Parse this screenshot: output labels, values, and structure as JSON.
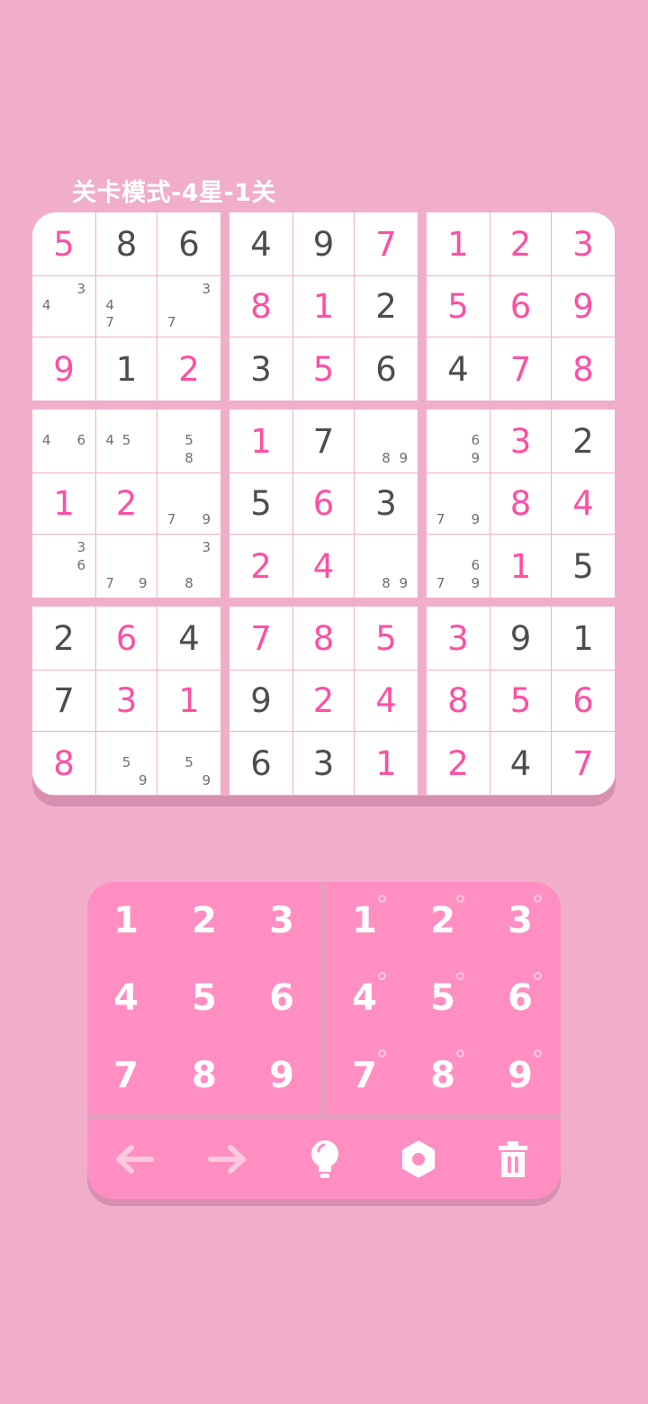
{
  "header": {
    "title": "关卡模式-4星-1关"
  },
  "board": {
    "rows": [
      [
        {
          "v": "5",
          "t": "user"
        },
        {
          "v": "8",
          "t": "given"
        },
        {
          "v": "6",
          "t": "given"
        },
        {
          "v": "4",
          "t": "given"
        },
        {
          "v": "9",
          "t": "given"
        },
        {
          "v": "7",
          "t": "user"
        },
        {
          "v": "1",
          "t": "user"
        },
        {
          "v": "2",
          "t": "user"
        },
        {
          "v": "3",
          "t": "user"
        }
      ],
      [
        {
          "n": [
            3,
            4
          ]
        },
        {
          "n": [
            4,
            7
          ]
        },
        {
          "n": [
            3,
            7
          ]
        },
        {
          "v": "8",
          "t": "user"
        },
        {
          "v": "1",
          "t": "user"
        },
        {
          "v": "2",
          "t": "given"
        },
        {
          "v": "5",
          "t": "user"
        },
        {
          "v": "6",
          "t": "user"
        },
        {
          "v": "9",
          "t": "user"
        }
      ],
      [
        {
          "v": "9",
          "t": "user"
        },
        {
          "v": "1",
          "t": "given"
        },
        {
          "v": "2",
          "t": "user"
        },
        {
          "v": "3",
          "t": "given"
        },
        {
          "v": "5",
          "t": "user"
        },
        {
          "v": "6",
          "t": "given"
        },
        {
          "v": "4",
          "t": "given"
        },
        {
          "v": "7",
          "t": "user"
        },
        {
          "v": "8",
          "t": "user"
        }
      ],
      [
        {
          "n": [
            4,
            6
          ]
        },
        {
          "n": [
            4,
            5
          ]
        },
        {
          "n": [
            5,
            8
          ]
        },
        {
          "v": "1",
          "t": "user"
        },
        {
          "v": "7",
          "t": "given"
        },
        {
          "n": [
            8,
            9
          ]
        },
        {
          "n": [
            6,
            9
          ]
        },
        {
          "v": "3",
          "t": "user"
        },
        {
          "v": "2",
          "t": "given"
        }
      ],
      [
        {
          "v": "1",
          "t": "user"
        },
        {
          "v": "2",
          "t": "user"
        },
        {
          "n": [
            7,
            9
          ]
        },
        {
          "v": "5",
          "t": "given"
        },
        {
          "v": "6",
          "t": "user"
        },
        {
          "v": "3",
          "t": "given"
        },
        {
          "n": [
            7,
            9
          ]
        },
        {
          "v": "8",
          "t": "user"
        },
        {
          "v": "4",
          "t": "user"
        }
      ],
      [
        {
          "n": [
            3,
            6
          ]
        },
        {
          "n": [
            7,
            9
          ]
        },
        {
          "n": [
            3,
            8
          ]
        },
        {
          "v": "2",
          "t": "user"
        },
        {
          "v": "4",
          "t": "user"
        },
        {
          "n": [
            8,
            9
          ]
        },
        {
          "n": [
            6,
            7,
            9
          ]
        },
        {
          "v": "1",
          "t": "user"
        },
        {
          "v": "5",
          "t": "given"
        }
      ],
      [
        {
          "v": "2",
          "t": "given"
        },
        {
          "v": "6",
          "t": "user"
        },
        {
          "v": "4",
          "t": "given"
        },
        {
          "v": "7",
          "t": "user"
        },
        {
          "v": "8",
          "t": "user"
        },
        {
          "v": "5",
          "t": "user"
        },
        {
          "v": "3",
          "t": "user"
        },
        {
          "v": "9",
          "t": "given"
        },
        {
          "v": "1",
          "t": "given"
        }
      ],
      [
        {
          "v": "7",
          "t": "given"
        },
        {
          "v": "3",
          "t": "user"
        },
        {
          "v": "1",
          "t": "user"
        },
        {
          "v": "9",
          "t": "given"
        },
        {
          "v": "2",
          "t": "user"
        },
        {
          "v": "4",
          "t": "user"
        },
        {
          "v": "8",
          "t": "user"
        },
        {
          "v": "5",
          "t": "user"
        },
        {
          "v": "6",
          "t": "user"
        }
      ],
      [
        {
          "v": "8",
          "t": "user"
        },
        {
          "n": [
            5,
            9
          ]
        },
        {
          "n": [
            5,
            9
          ]
        },
        {
          "v": "6",
          "t": "given"
        },
        {
          "v": "3",
          "t": "given"
        },
        {
          "v": "1",
          "t": "user"
        },
        {
          "v": "2",
          "t": "user"
        },
        {
          "v": "4",
          "t": "given"
        },
        {
          "v": "7",
          "t": "user"
        }
      ]
    ]
  },
  "keypad": {
    "number_keys": [
      "1",
      "2",
      "3",
      "4",
      "5",
      "6",
      "7",
      "8",
      "9"
    ],
    "note_keys": [
      "1",
      "2",
      "3",
      "4",
      "5",
      "6",
      "7",
      "8",
      "9"
    ]
  },
  "toolbar": {
    "items": [
      {
        "name": "undo-arrow-icon"
      },
      {
        "name": "redo-arrow-icon"
      },
      {
        "name": "hint-lightbulb-icon"
      },
      {
        "name": "settings-gear-icon"
      },
      {
        "name": "delete-trash-icon"
      }
    ]
  },
  "colors": {
    "background": "#f0aecb",
    "accent": "#ff4fa3",
    "given_digit": "#4d4d4d",
    "pad": "#ff8ec3"
  }
}
